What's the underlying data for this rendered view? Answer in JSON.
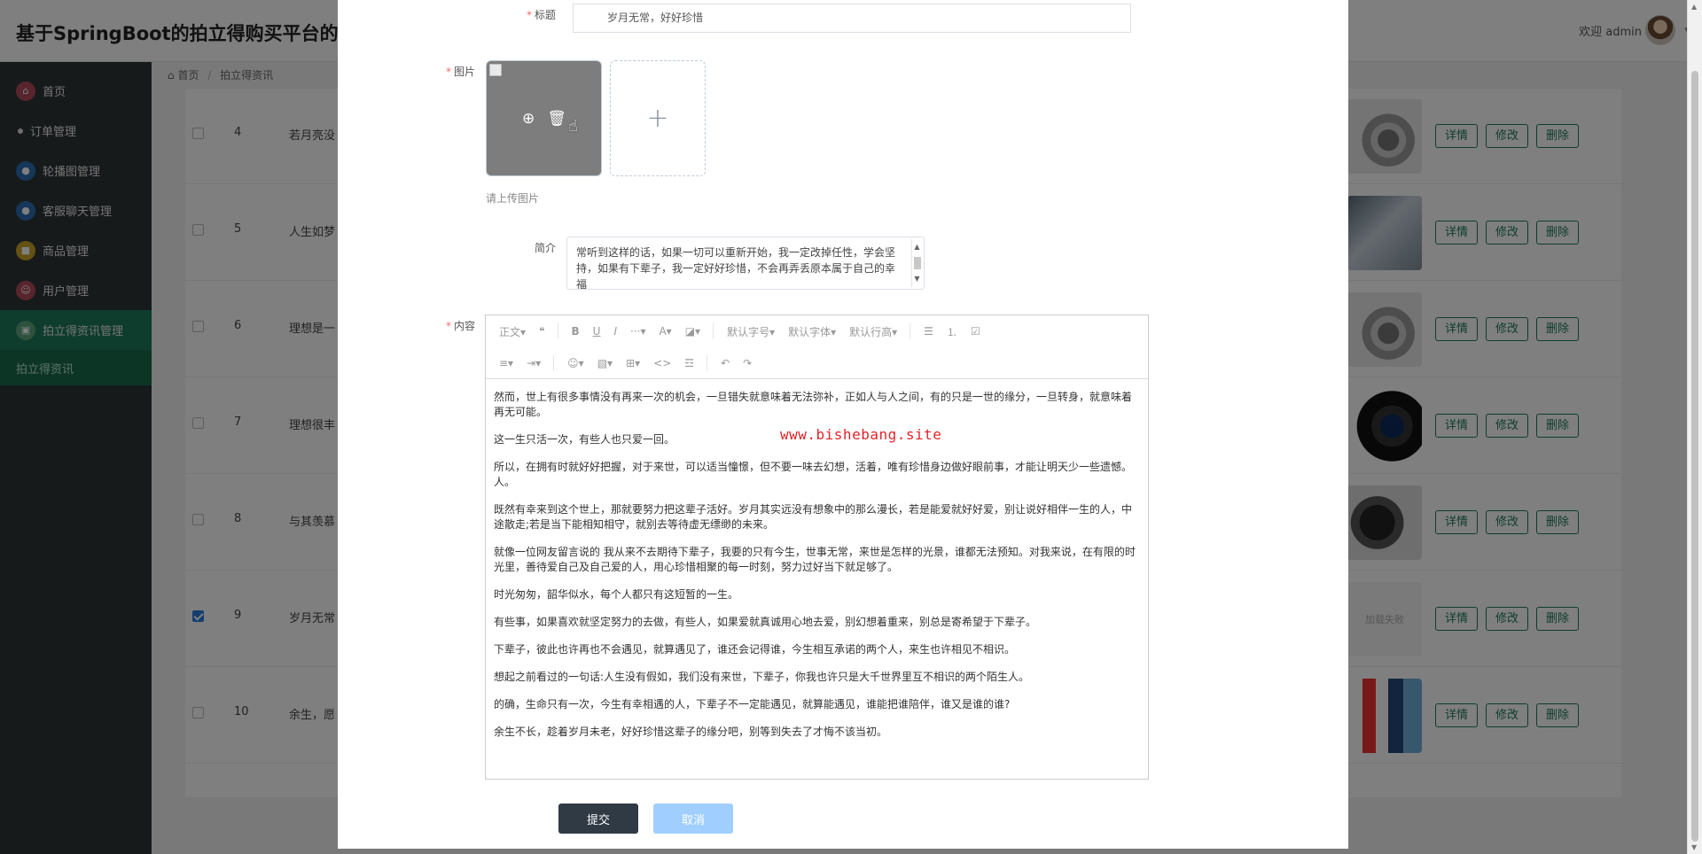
{
  "app": {
    "title": "基于SpringBoot的拍立得购买平台的设",
    "welcome": "欢迎 admin"
  },
  "sidebar": {
    "items": [
      {
        "label": "首页",
        "icon": "home-icon",
        "color": "#b04a5a"
      },
      {
        "label": "订单管理",
        "icon": "dot-icon",
        "color": "#dddddd"
      },
      {
        "label": "轮播图管理",
        "icon": "carousel-icon",
        "color": "#2d6fb3"
      },
      {
        "label": "客服聊天管理",
        "icon": "chat-icon",
        "color": "#2d6fb3"
      },
      {
        "label": "商品管理",
        "icon": "goods-icon",
        "color": "#c9a227"
      },
      {
        "label": "用户管理",
        "icon": "user-icon",
        "color": "#b04a5a"
      },
      {
        "label": "拍立得资讯管理",
        "icon": "news-icon",
        "color": "#5aa37a"
      }
    ],
    "active_sub": "拍立得资讯"
  },
  "breadcrumb": {
    "home": "首页",
    "current": "拍立得资讯"
  },
  "table": {
    "rows": [
      {
        "num": "4",
        "title": "若月亮没",
        "checked": false,
        "thumb": "cam"
      },
      {
        "num": "5",
        "title": "人生如梦",
        "checked": false,
        "thumb": "photo"
      },
      {
        "num": "6",
        "title": "理想是一",
        "checked": false,
        "thumb": "cam"
      },
      {
        "num": "7",
        "title": "理想很丰",
        "checked": false,
        "thumb": "dark"
      },
      {
        "num": "8",
        "title": "与其羡慕",
        "checked": false,
        "thumb": "vid"
      },
      {
        "num": "9",
        "title": "岁月无常",
        "checked": true,
        "thumb": "fail"
      },
      {
        "num": "10",
        "title": "余生，愿",
        "checked": false,
        "thumb": "phone"
      }
    ],
    "thumb_fail_text": "加载失败",
    "actions": {
      "detail": "详情",
      "edit": "修改",
      "delete": "删除"
    }
  },
  "form": {
    "title_label": "标题",
    "title_value": "岁月无常，好好珍惜",
    "image_label": "图片",
    "upload_hint": "请上传图片",
    "intro_label": "简介",
    "intro_value": "常听到这样的话，如果一切可以重新开始，我一定改掉任性，学会坚持，如果有下辈子，我一定好好珍惜，不会再弄丢原本属于自己的幸福",
    "content_label": "内容",
    "toolbar": {
      "row1": [
        "正文▾",
        "❝",
        "B",
        "U",
        "I",
        "···▾",
        "A▾",
        "◪▾",
        "默认字号▾",
        "默认字体▾",
        "默认行高▾",
        "☰",
        "⒈",
        "☑"
      ],
      "row2": [
        "≡▾",
        "⇥▾",
        "☺▾",
        "▧▾",
        "⊞▾",
        "<>",
        "☲",
        "↶",
        "↷"
      ]
    },
    "content_paragraphs": [
      "然而，世上有很多事情没有再来一次的机会，一旦错失就意味着无法弥补，正如人与人之间，有的只是一世的缘分，一旦转身，就意味着再无可能。",
      "这一生只活一次，有些人也只爱一回。",
      "所以，在拥有时就好好把握，对于来世，可以适当憧憬，但不要一味去幻想，活着，唯有珍惜身边做好眼前事，才能让明天少一些遗憾。人。",
      "既然有幸来到这个世上，那就要努力把这辈子活好。岁月其实远没有想象中的那么漫长，若是能爱就好好爱，别让说好相伴一生的人，中途散走;若是当下能相知相守，就别去等待虚无缥缈的未来。",
      "就像一位网友留言说的 我从来不去期待下辈子，我要的只有今生，世事无常，来世是怎样的光景，谁都无法预知。对我来说，在有限的时光里，善待爱自己及自己爱的人，用心珍惜相聚的每一时刻，努力过好当下就足够了。",
      "时光匆匆，韶华似水，每个人都只有这短暂的一生。",
      "有些事，如果喜欢就坚定努力的去做，有些人，如果爱就真诚用心地去爱，别幻想着重来，别总是寄希望于下辈子。",
      "下辈子，彼此也许再也不会遇见，就算遇见了，谁还会记得谁，今生相互承诺的两个人，来生也许相见不相识。",
      "想起之前看过的一句话:人生没有假如，我们没有来世，下辈子，你我也许只是大千世界里互不相识的两个陌生人。",
      "的确，生命只有一次，今生有幸相遇的人，下辈子不一定能遇见，就算能遇见，谁能把谁陪伴，谁又是谁的谁?",
      "余生不长，趁着岁月未老，好好珍惜这辈子的缘分吧，别等到失去了才悔不该当初。"
    ],
    "watermark": "www.bishebang.site",
    "submit_label": "提交",
    "cancel_label": "取消"
  }
}
